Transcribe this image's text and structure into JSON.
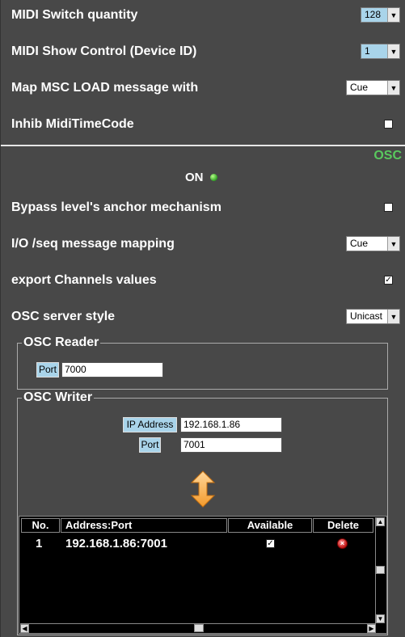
{
  "midi": {
    "switch_quantity": {
      "label": "MIDI Switch quantity",
      "value": "128"
    },
    "show_control": {
      "label": "MIDI Show Control (Device ID)",
      "value": "1"
    },
    "msc_load": {
      "label": "Map MSC LOAD message with",
      "value": "Cue"
    },
    "inhib_mtc": {
      "label": "Inhib MidiTimeCode",
      "checked": false
    }
  },
  "osc": {
    "section_tag": "OSC",
    "status_text": "ON",
    "status_color": "#59c95e",
    "bypass_anchor": {
      "label": "Bypass level's anchor mechanism",
      "checked": false
    },
    "io_seq_mapping": {
      "label": "I/O /seq message mapping",
      "value": "Cue"
    },
    "export_channels": {
      "label": "export Channels values",
      "checked": true
    },
    "server_style": {
      "label": "OSC server style",
      "value": "Unicast"
    },
    "reader": {
      "title": "OSC Reader",
      "port_label": "Port",
      "port_value": "7000"
    },
    "writer": {
      "title": "OSC Writer",
      "ip_label": "IP Address",
      "ip_value": "192.168.1.86",
      "port_label": "Port",
      "port_value": "7001",
      "swap_icon": "swap-vertical-arrows-icon",
      "table": {
        "columns": [
          "No.",
          "Address:Port",
          "Available",
          "Delete"
        ],
        "rows": [
          {
            "no": "1",
            "address": "192.168.1.86:7001",
            "available": true,
            "delete_icon": "delete-icon"
          }
        ]
      }
    }
  },
  "colors": {
    "background": "#484848",
    "accent_label": "#a9d4ea",
    "osc_green": "#59c95e"
  }
}
